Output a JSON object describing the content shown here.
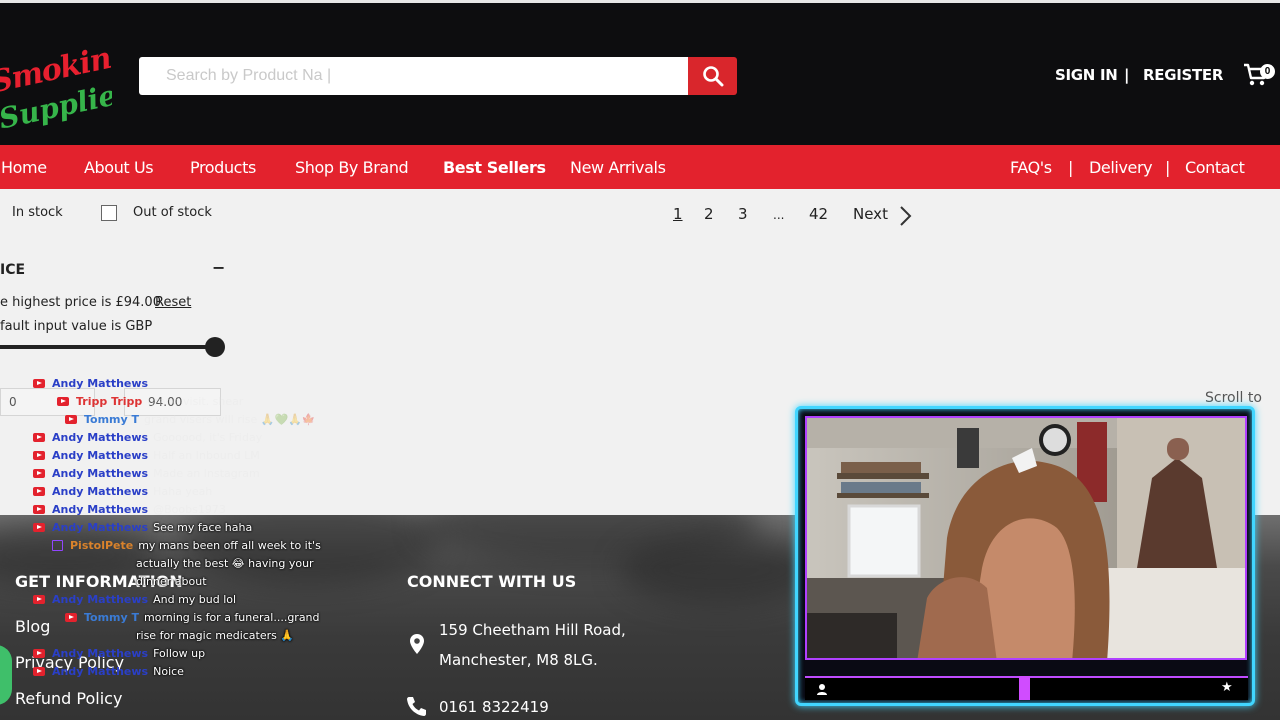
{
  "header": {
    "logo_line1": "Smoking",
    "logo_line2": "Supplier",
    "search_placeholder": "Search by Product Na |",
    "sign_in": "SIGN IN",
    "divider": "|",
    "register": "REGISTER",
    "cart_count": "0"
  },
  "nav": {
    "left": [
      "Home",
      "About Us",
      "Products",
      "Shop By Brand",
      "Best Sellers",
      "New Arrivals"
    ],
    "right": [
      "FAQ's",
      "Delivery",
      "Contact"
    ],
    "separator": "|"
  },
  "filters": {
    "in_stock": "In stock",
    "out_of_stock": "Out of stock",
    "price_heading": "ICE",
    "collapse": "−",
    "highest_price": "e highest price is £94.00",
    "reset": "Reset",
    "default_input": "fault input value is GBP",
    "min_value": "0",
    "max_value": "94.00"
  },
  "pagination": {
    "pages": [
      "1",
      "2",
      "3",
      "...",
      "42"
    ],
    "next": "Next"
  },
  "scroll_to_top": "Scroll to To",
  "chat": [
    {
      "platform": "youtube",
      "name": "Andy Matthews",
      "msg": "",
      "faded": false
    },
    {
      "platform": "youtube",
      "name": "Tripp Tripp",
      "msg": "grand visit. shear",
      "faded": true
    },
    {
      "platform": "youtube",
      "name": "Tommy T",
      "msg": "grand visers will rise 🙏💚🙏🍁",
      "faded": true
    },
    {
      "platform": "youtube",
      "name": "Andy Matthews",
      "msg": "Goooood, it's Friday",
      "faded": true
    },
    {
      "platform": "youtube",
      "name": "Andy Matthews",
      "msg": "Half an Inbound LM",
      "faded": true
    },
    {
      "platform": "youtube",
      "name": "Andy Matthews",
      "msg": "Made an Instagram",
      "faded": true
    },
    {
      "platform": "youtube",
      "name": "Andy Matthews",
      "msg": "Haha yeah",
      "faded": true
    },
    {
      "platform": "youtube",
      "name": "Andy Matthews",
      "msg": "@Boobs1973",
      "faded": true
    },
    {
      "platform": "youtube",
      "name": "Andy Matthews",
      "msg": "See my face haha",
      "faded": false
    },
    {
      "platform": "twitch",
      "name": "PistolPete",
      "msg": "my mans been off all week to it's",
      "faded": false
    },
    {
      "platform": "",
      "name": "",
      "msg": "actually the best 😂 having your",
      "faded": false
    },
    {
      "platform": "",
      "name": "",
      "msg": "dinner about",
      "faded": false
    },
    {
      "platform": "youtube",
      "name": "Andy Matthews",
      "msg": "And my bud lol",
      "faded": false
    },
    {
      "platform": "youtube",
      "name": "Tommy T",
      "msg": "morning is for a funeral....grand",
      "faded": false
    },
    {
      "platform": "",
      "name": "",
      "msg": "rise for magic medicaters 🙏",
      "faded": false
    },
    {
      "platform": "youtube",
      "name": "Andy Matthews",
      "msg": "Follow up",
      "faded": false
    },
    {
      "platform": "youtube",
      "name": "Andy Matthews",
      "msg": "Noice",
      "faded": false
    }
  ],
  "footer": {
    "get_info": "GET INFORMATION",
    "links": [
      "Blog",
      "Privacy Policy",
      "Refund Policy"
    ],
    "connect": "CONNECT WITH US",
    "address1": "159 Cheetham Hill Road,",
    "address2": "Manchester, M8 8LG.",
    "phone": "0161 8322419"
  },
  "colors": {
    "brand_red": "#e3222d",
    "header_black": "#0d0d0f",
    "cam_cyan": "#41d6ff",
    "cam_purple": "#b040ff"
  }
}
